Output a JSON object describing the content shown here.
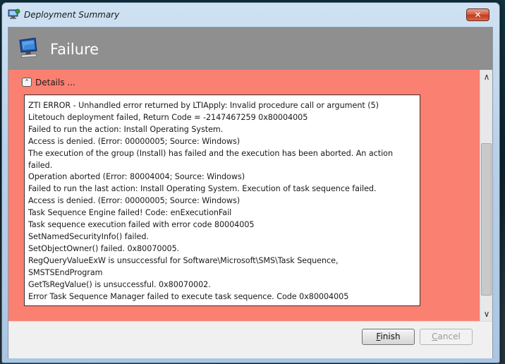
{
  "window": {
    "title": "Deployment Summary",
    "close_label": "✕"
  },
  "header": {
    "title": "Failure"
  },
  "details": {
    "toggle_symbol": "⌃",
    "label": "Details ..."
  },
  "log_lines": [
    "ZTI ERROR - Unhandled error returned by LTIApply: Invalid procedure call or argument (5)",
    "Litetouch deployment failed, Return Code = -2147467259  0x80004005",
    "Failed to run the action: Install Operating System.",
    "Access is denied. (Error: 00000005; Source: Windows)",
    "The execution of the group (Install) has failed and the execution has been aborted. An action",
    "failed.",
    "Operation aborted (Error: 80004004; Source: Windows)",
    "Failed to run the last action: Install Operating System. Execution of task sequence failed.",
    "Access is denied. (Error: 00000005; Source: Windows)",
    "Task Sequence Engine failed! Code: enExecutionFail",
    "Task sequence execution failed with error code 80004005",
    "SetNamedSecurityInfo() failed.",
    "SetObjectOwner() failed. 0x80070005.",
    "RegQueryValueExW is unsuccessful for Software\\Microsoft\\SMS\\Task Sequence,",
    "SMSTSEndProgram",
    "GetTsRegValue() is unsuccessful. 0x80070002.",
    "Error Task Sequence Manager failed to execute task sequence. Code 0x80004005"
  ],
  "buttons": {
    "finish": "Finish",
    "cancel": "Cancel"
  },
  "colors": {
    "failure_background": "#fa8072",
    "header_background": "#8f8f8f"
  },
  "icons": {
    "title": "setup-computer-icon",
    "header": "computer-monitor-icon"
  }
}
